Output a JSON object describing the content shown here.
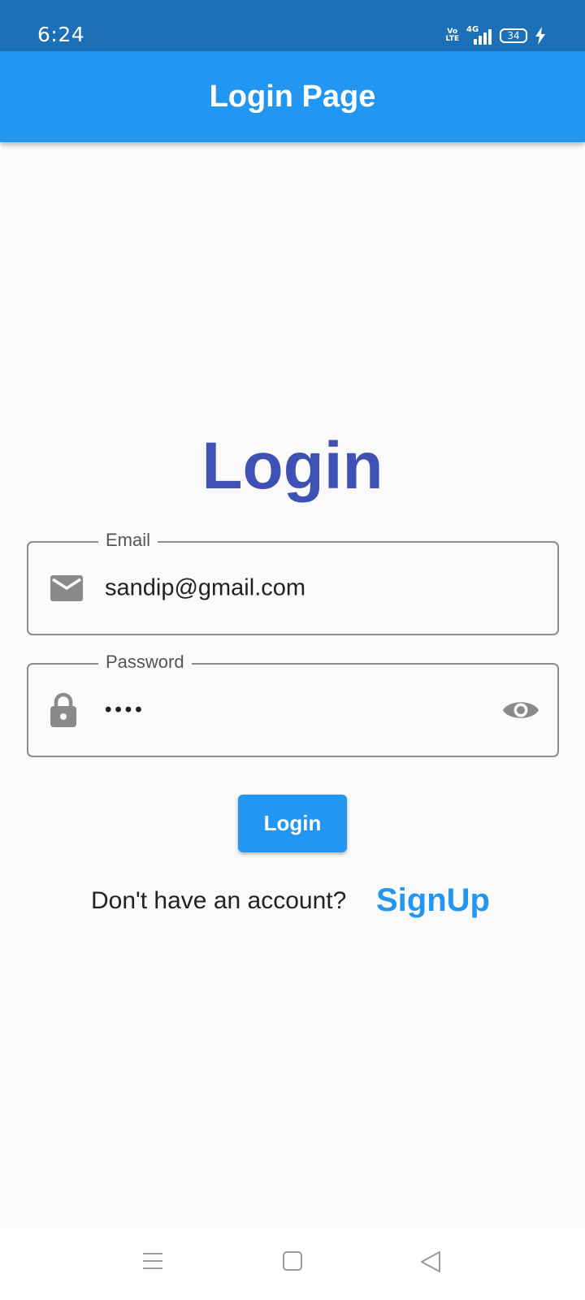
{
  "status_bar": {
    "time": "6:24",
    "volte_label": "Vo LTE",
    "network_label": "4G",
    "battery_level": "34"
  },
  "app_bar": {
    "title": "Login Page"
  },
  "form": {
    "heading": "Login",
    "email": {
      "label": "Email",
      "value": "sandip@gmail.com",
      "icon": "mail-icon"
    },
    "password": {
      "label": "Password",
      "value": "••••",
      "icon": "lock-icon",
      "toggle_icon": "eye-icon"
    },
    "login_button": "Login",
    "signup_prompt": "Don't have an account?",
    "signup_link": "SignUp"
  },
  "colors": {
    "status_bar": "#1b70b8",
    "app_bar": "#2196f3",
    "heading": "#3f51b5",
    "accent": "#2196f3"
  },
  "nav_bar": {
    "icons": [
      "menu-icon",
      "home-icon",
      "back-icon"
    ]
  }
}
